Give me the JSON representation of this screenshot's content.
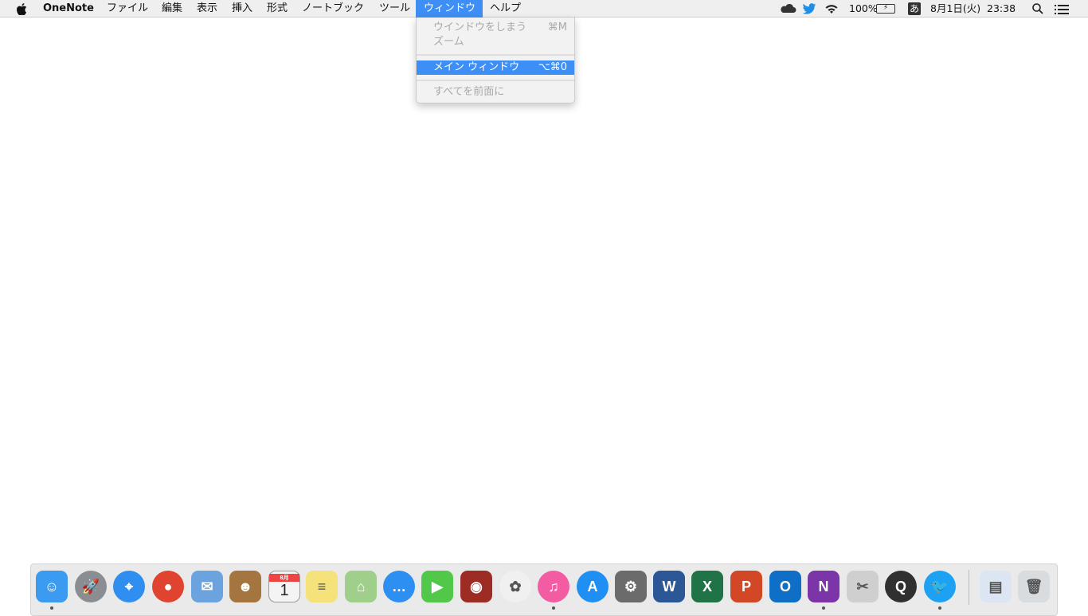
{
  "menubar": {
    "app_name": "OneNote",
    "menus": [
      "ファイル",
      "編集",
      "表示",
      "挿入",
      "形式",
      "ノートブック",
      "ツール",
      "ウィンドウ",
      "ヘルプ"
    ],
    "status": {
      "battery": "100%",
      "input_method": "あ",
      "date": "8月1日(火)",
      "time": "23:38"
    }
  },
  "window_menu": {
    "items": [
      {
        "label": "ウインドウをしまう",
        "shortcut": "⌘M",
        "enabled": false
      },
      {
        "label": "ズーム",
        "shortcut": "",
        "enabled": false
      },
      {
        "label": "メイン ウィンドウ",
        "shortcut": "⌥⌘0",
        "enabled": true,
        "highlighted": true
      },
      {
        "label": "すべてを前面に",
        "shortcut": "",
        "enabled": false
      }
    ]
  },
  "dock": {
    "calendar_month": "8月",
    "calendar_day": "1",
    "apps": [
      {
        "name": "Finder",
        "glyph": "☺",
        "color": "#3b9bf0",
        "running": true
      },
      {
        "name": "Launchpad",
        "glyph": "🚀",
        "color": "#8a8d92"
      },
      {
        "name": "Safari",
        "glyph": "⌖",
        "color": "#2f8ef0"
      },
      {
        "name": "Chrome",
        "glyph": "●",
        "color": "#e0432f"
      },
      {
        "name": "Mail",
        "glyph": "✉",
        "color": "#6aa3dd"
      },
      {
        "name": "Contacts",
        "glyph": "☻",
        "color": "#a4753f"
      },
      {
        "name": "Calendar",
        "glyph": "",
        "color": "#f4f4f4"
      },
      {
        "name": "Notes",
        "glyph": "≡",
        "color": "#f6e27a"
      },
      {
        "name": "Maps",
        "glyph": "⌂",
        "color": "#9fcf8a"
      },
      {
        "name": "Messages",
        "glyph": "…",
        "color": "#2e8ff2"
      },
      {
        "name": "FaceTime",
        "glyph": "▶",
        "color": "#52c84b"
      },
      {
        "name": "Photo Booth",
        "glyph": "◉",
        "color": "#9d2c24"
      },
      {
        "name": "Photos",
        "glyph": "✿",
        "color": "#f0f0f0"
      },
      {
        "name": "iTunes",
        "glyph": "♫",
        "color": "#f35ba3",
        "running": true
      },
      {
        "name": "App Store",
        "glyph": "A",
        "color": "#1f8ff3"
      },
      {
        "name": "System Preferences",
        "glyph": "⚙",
        "color": "#6b6b6b"
      },
      {
        "name": "Word",
        "glyph": "W",
        "color": "#2b5797"
      },
      {
        "name": "Excel",
        "glyph": "X",
        "color": "#207346"
      },
      {
        "name": "PowerPoint",
        "glyph": "P",
        "color": "#d24726"
      },
      {
        "name": "Outlook",
        "glyph": "O",
        "color": "#0f6fc6"
      },
      {
        "name": "OneNote",
        "glyph": "N",
        "color": "#7b35a8",
        "running": true
      },
      {
        "name": "Grab",
        "glyph": "✂",
        "color": "#cfcfcf"
      },
      {
        "name": "QuickTime Player",
        "glyph": "Q",
        "color": "#303030"
      },
      {
        "name": "Twitter",
        "glyph": "🐦",
        "color": "#1da1f2",
        "running": true
      },
      {
        "name": "Downloads",
        "glyph": "▤",
        "color": "#dbe6f2"
      },
      {
        "name": "Trash",
        "glyph": "🗑",
        "color": "#d9dcdf"
      }
    ]
  }
}
